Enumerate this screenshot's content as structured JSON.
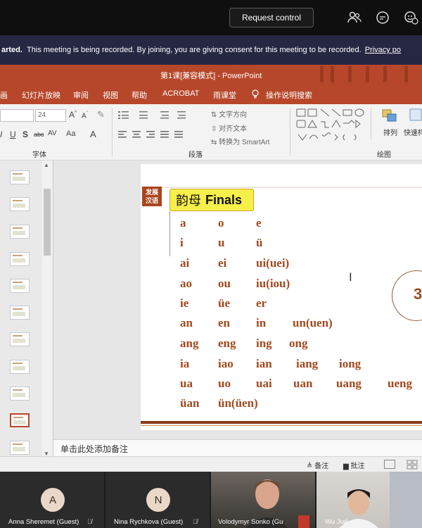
{
  "teams": {
    "request_control": "Request control",
    "banner_bold": "arted.",
    "banner_text": "This meeting is being recorded. By joining, you are giving consent for this meeting to be recorded.",
    "banner_link": "Privacy po"
  },
  "ppt": {
    "window_title": "第1课[兼容模式]  -  PowerPoint",
    "tabs": [
      "画",
      "幻灯片放映",
      "审阅",
      "视图",
      "帮助",
      "ACROBAT",
      "雨课堂",
      "操作说明搜索"
    ],
    "ribbon": {
      "font_size": "24",
      "group_font": "字体",
      "group_paragraph": "段落",
      "group_drawing": "绘图",
      "text_direction": "文字方向",
      "align_text": "对齐文本",
      "convert_smartart": "转换为 SmartArt",
      "arrange": "排列",
      "quick_styles": "快速样"
    }
  },
  "thumbs": {
    "numbers": [
      "",
      "",
      "",
      "",
      "",
      "",
      "",
      "",
      "",
      "",
      "",
      ""
    ]
  },
  "slide": {
    "logo_line1": "发展",
    "logo_line2": "汉语",
    "title_cn": "韵母",
    "title_en": "Finals",
    "oval_number": "3",
    "finals": [
      [
        "a",
        "o",
        "e"
      ],
      [
        "i",
        "u",
        "ü"
      ],
      [
        "ai",
        "ei",
        "ui(uei)"
      ],
      [
        "ao",
        "ou",
        "iu(iou)"
      ],
      [
        "ie",
        "üe",
        "er"
      ],
      [
        "an",
        "en",
        "in",
        "un(uen)"
      ],
      [
        "ang",
        "eng",
        "ing",
        "ong"
      ],
      [
        "ia",
        "iao",
        "ian",
        "iang",
        "iong"
      ],
      [
        "ua",
        "uo",
        "uai",
        "uan",
        "uang",
        "ueng"
      ],
      [
        "üan",
        "ün(üen)"
      ]
    ]
  },
  "notes_placeholder": "单击此处添加备注",
  "status": {
    "notes_label": "备注",
    "comments_label": "批注"
  },
  "participants": [
    {
      "initial": "A",
      "name": "Anna Sheremet (Guest)"
    },
    {
      "initial": "N",
      "name": "Nina Rychkova (Guest)"
    },
    {
      "initial": "",
      "name": "Volodymyr Sonko (Gu"
    },
    {
      "initial": "",
      "name": "Wu Jiali"
    }
  ]
}
